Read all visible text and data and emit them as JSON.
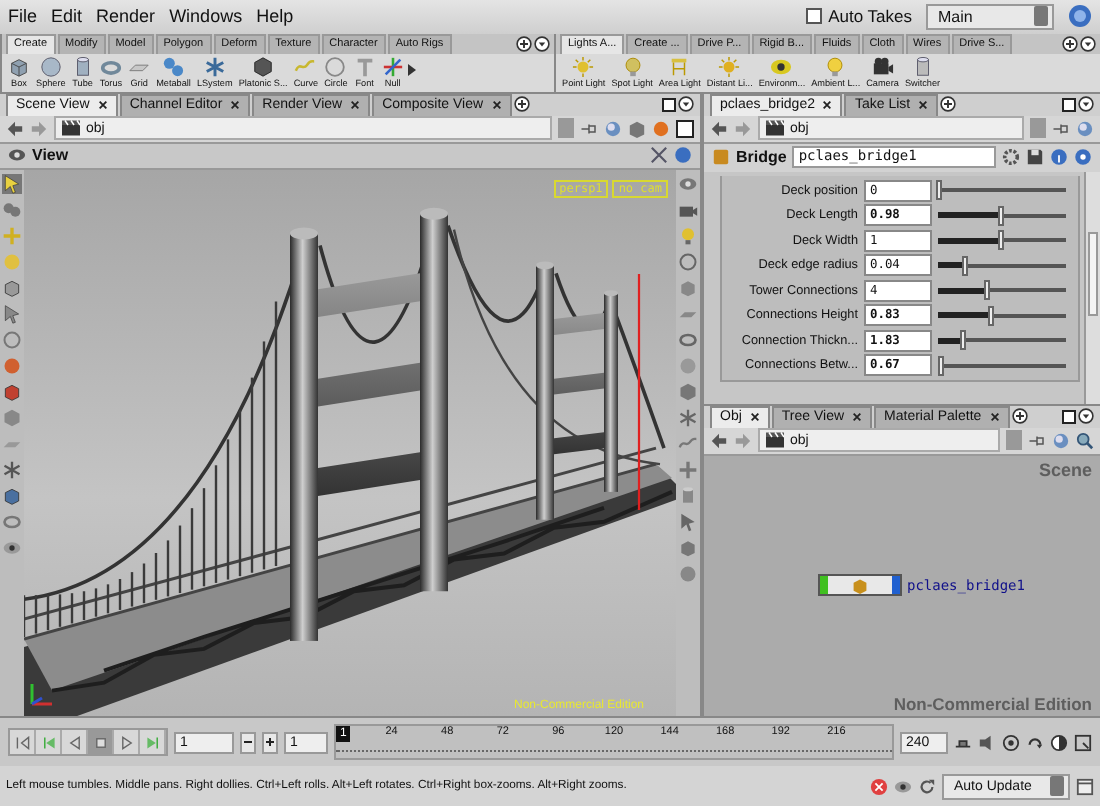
{
  "menu_bar": {
    "items": [
      "File",
      "Edit",
      "Render",
      "Windows",
      "Help"
    ],
    "auto_takes": {
      "label": "Auto Takes",
      "checked": false
    },
    "take": "Main"
  },
  "shelves": [
    {
      "tabs": [
        {
          "label": "Create",
          "selected": true
        },
        {
          "label": "Modify",
          "selected": false
        },
        {
          "label": "Model",
          "selected": false
        },
        {
          "label": "Polygon",
          "selected": false
        },
        {
          "label": "Deform",
          "selected": false
        },
        {
          "label": "Texture",
          "selected": false
        },
        {
          "label": "Character",
          "selected": false
        },
        {
          "label": "Auto Rigs",
          "selected": false
        }
      ],
      "tools": [
        "Box",
        "Sphere",
        "Tube",
        "Torus",
        "Grid",
        "Metaball",
        "LSystem",
        "Platonic S...",
        "Curve",
        "Circle",
        "Font",
        "Null"
      ]
    },
    {
      "tabs": [
        {
          "label": "Lights A...",
          "selected": true
        },
        {
          "label": "Create ...",
          "selected": false
        },
        {
          "label": "Drive P...",
          "selected": false
        },
        {
          "label": "Rigid B...",
          "selected": false
        },
        {
          "label": "Fluids",
          "selected": false
        },
        {
          "label": "Cloth",
          "selected": false
        },
        {
          "label": "Wires",
          "selected": false
        },
        {
          "label": "Drive S...",
          "selected": false
        }
      ],
      "tools": [
        "Point Light",
        "Spot Light",
        "Area Light",
        "Distant Li...",
        "Environm...",
        "Ambient L...",
        "Camera",
        "Switcher"
      ]
    }
  ],
  "viewer_pane": {
    "tabs": [
      {
        "label": "Scene View",
        "selected": true
      },
      {
        "label": "Channel Editor",
        "selected": false
      },
      {
        "label": "Render View",
        "selected": false
      },
      {
        "label": "Composite View",
        "selected": false
      }
    ],
    "path": "obj",
    "title": "View",
    "camera": "persp1",
    "camera_mode": "no cam",
    "edition": "Non-Commercial Edition"
  },
  "parameters_pane": {
    "tabs": [
      {
        "label": "pclaes_bridge2",
        "selected": true
      },
      {
        "label": "Take List",
        "selected": false
      }
    ],
    "path": "obj",
    "node_type": "Bridge",
    "node_name": "pclaes_bridge1",
    "parameters": [
      {
        "label": "Deck position",
        "value": "0",
        "modified": false,
        "level": 0
      },
      {
        "label": "Deck Length",
        "value": "0.98",
        "modified": true,
        "level": 0.48
      },
      {
        "label": "Deck Width",
        "value": "1",
        "modified": false,
        "level": 0.49
      },
      {
        "label": "Deck edge radius",
        "value": "0.04",
        "modified": false,
        "level": 0.2
      },
      {
        "label": "Tower Connections",
        "value": "4",
        "modified": false,
        "level": 0.37
      },
      {
        "label": "Connections Height",
        "value": "0.83",
        "modified": true,
        "level": 0.41
      },
      {
        "label": "Connection Thickn...",
        "value": "1.83",
        "modified": true,
        "level": 0.19
      },
      {
        "label": "Connections Betw...",
        "value": "0.67",
        "modified": true,
        "level": 0.02
      }
    ]
  },
  "network_pane": {
    "tabs": [
      {
        "label": "Obj",
        "selected": true
      },
      {
        "label": "Tree View",
        "selected": false
      },
      {
        "label": "Material Palette",
        "selected": false
      }
    ],
    "path": "obj",
    "context": "Scene",
    "nodes": [
      {
        "name": "pclaes_bridge1",
        "display": true,
        "render": true
      }
    ],
    "edition": "Non-Commercial Edition"
  },
  "playbar": {
    "frame": "1",
    "start": "1",
    "current": "1",
    "ticks": [
      "24",
      "48",
      "72",
      "96",
      "120",
      "144",
      "168",
      "192",
      "216"
    ],
    "end": "240"
  },
  "status_bar": {
    "message": "Left mouse tumbles. Middle pans. Right dollies. Ctrl+Left rolls. Alt+Left rotates. Ctrl+Right box-zooms. Alt+Right zooms.",
    "update_mode": "Auto Update"
  }
}
